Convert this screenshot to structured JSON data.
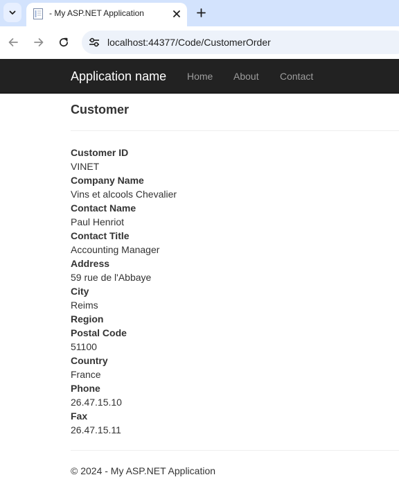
{
  "browser": {
    "tab_title": "- My ASP.NET Application",
    "url": "localhost:44377/Code/CustomerOrder"
  },
  "navbar": {
    "brand": "Application name",
    "links": [
      "Home",
      "About",
      "Contact"
    ]
  },
  "page": {
    "title": "Customer",
    "fields": [
      {
        "label": "Customer ID",
        "value": "VINET"
      },
      {
        "label": "Company Name",
        "value": "Vins et alcools Chevalier"
      },
      {
        "label": "Contact Name",
        "value": "Paul Henriot"
      },
      {
        "label": "Contact Title",
        "value": "Accounting Manager"
      },
      {
        "label": "Address",
        "value": "59 rue de l'Abbaye"
      },
      {
        "label": "City",
        "value": "Reims"
      },
      {
        "label": "Region",
        "value": ""
      },
      {
        "label": "Postal Code",
        "value": "51100"
      },
      {
        "label": "Country",
        "value": "France"
      },
      {
        "label": "Phone",
        "value": "26.47.15.10"
      },
      {
        "label": "Fax",
        "value": "26.47.15.11"
      }
    ]
  },
  "footer": {
    "text": "© 2024 - My ASP.NET Application"
  }
}
